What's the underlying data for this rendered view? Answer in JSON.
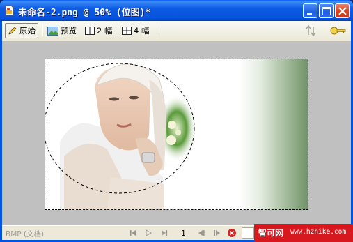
{
  "window": {
    "title": "未命名-2.png @  50% (位图)*",
    "controls": {
      "minimize": "minimize-icon",
      "maximize": "maximize-icon",
      "close": "close-icon"
    }
  },
  "toolbar": {
    "original_label": "原始",
    "preview_label": "预览",
    "two_up_label": "2 幅",
    "four_up_label": "4 幅",
    "icons": [
      "pencil-icon",
      "landscape-icon",
      "two-pane-icon",
      "four-pane-icon",
      "sort-icon",
      "key-icon"
    ]
  },
  "canvas": {
    "colors": {
      "background": "#c0c0c0",
      "gradient_end": "#6f9168"
    }
  },
  "statusbar": {
    "format": "BMP (文档)",
    "page": "1"
  },
  "watermark": {
    "brand": "智可网",
    "url": "www.hzhike.com"
  }
}
